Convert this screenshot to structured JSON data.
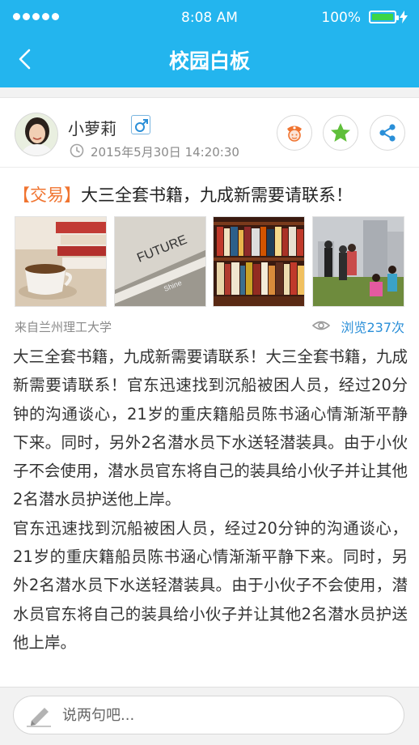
{
  "status_bar": {
    "time": "8:08 AM",
    "battery": "100%"
  },
  "nav": {
    "title": "校园白板"
  },
  "post": {
    "author": "小萝莉",
    "gender_symbol": "♂",
    "time": "2015年5月30日 14:20:30",
    "tag": "【交易】",
    "title": "大三全套书籍，九成新需要请联系！",
    "source": "来自兰州理工大学",
    "views": "浏览237次",
    "images": [
      "coffee-and-books-photo",
      "book-closeup-photo",
      "bookshelf-photo",
      "campus-crowd-photo"
    ],
    "paragraphs": [
      "大三全套书籍，九成新需要请联系！大三全套书籍，九成新需要请联系！官东迅速找到沉船被困人员，经过20分钟的沟通谈心，21岁的重庆籍船员陈书涵心情渐渐平静下来。同时，另外2名潜水员下水送轻潜装具。由于小伙子不会使用，潜水员官东将自己的装具给小伙子并让其他2名潜水员护送他上岸。",
      "官东迅速找到沉船被困人员，经过20分钟的沟通谈心，21岁的重庆籍船员陈书涵心情渐渐平静下来。同时，另外2名潜水员下水送轻潜装具。由于小伙子不会使用，潜水员官东将自己的装具给小伙子并让其他2名潜水员护送他上岸。"
    ]
  },
  "comment": {
    "placeholder": "说两句吧..."
  },
  "colors": {
    "primary": "#23b5ee",
    "tag": "#f07430",
    "link": "#2a8fd8",
    "favorite": "#5fbf3a",
    "report": "#f07430"
  }
}
